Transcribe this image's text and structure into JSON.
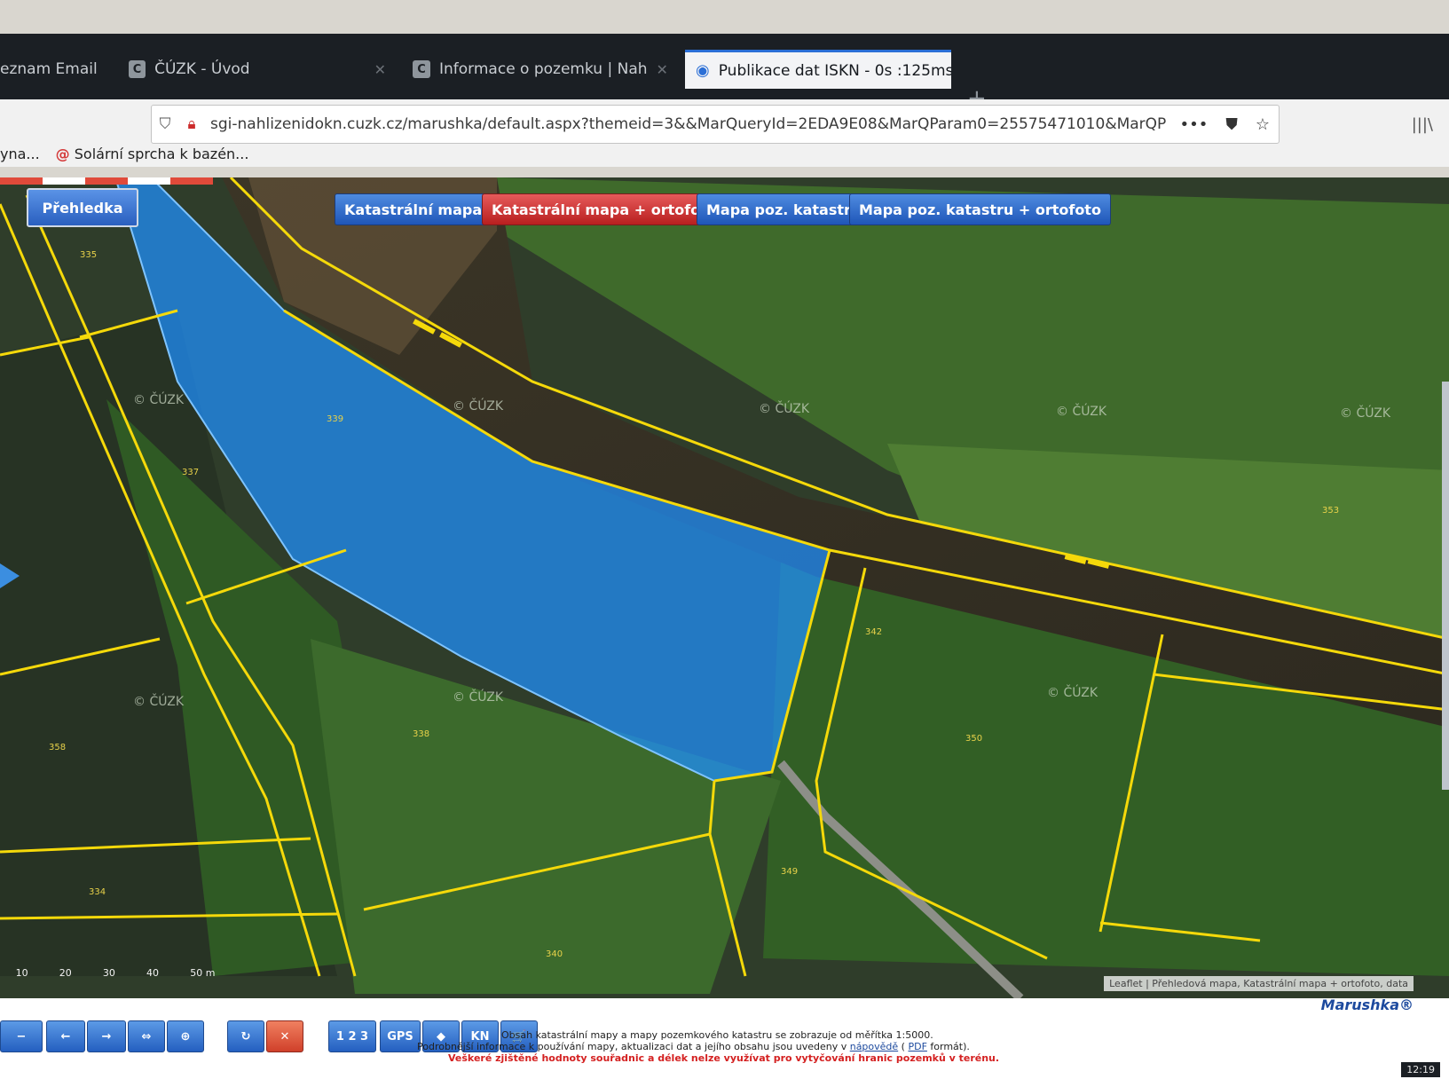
{
  "browser": {
    "tabs": [
      {
        "label": "eznam Email",
        "favicon": "email-icon",
        "active": false
      },
      {
        "label": "ČÚZK - Úvod",
        "favicon": "cuzk-icon",
        "active": false
      },
      {
        "label": "Informace o pozemku | Nah",
        "favicon": "cuzk-icon",
        "active": false
      },
      {
        "label": "Publikace dat ISKN - 0s :125ms,",
        "favicon": "globe-icon",
        "active": true
      }
    ],
    "new_tab_label": "+",
    "url": "sgi-nahlizenidokn.cuzk.cz/marushka/default.aspx?themeid=3&&MarQueryId=2EDA9E08&MarQParam0=25575471010&MarQP",
    "more_label": "•••",
    "bookmarks": [
      {
        "label": "yna...",
        "icon": "bookmark-icon"
      },
      {
        "label": "Solární sprcha k bazén...",
        "icon": "shop-icon"
      }
    ]
  },
  "map": {
    "overview_button": "Přehledka",
    "layer_buttons": [
      {
        "label": "Katastrální mapa",
        "active": false
      },
      {
        "label": "Katastrální mapa + ortofoto",
        "active": true
      },
      {
        "label": "Mapa poz. katastru",
        "active": false
      },
      {
        "label": "Mapa poz. katastru + ortofoto",
        "active": false
      }
    ],
    "watermark": "© ČÚZK",
    "parcel_numbers": [
      "335",
      "337",
      "338",
      "339",
      "349",
      "350",
      "353",
      "358",
      "334",
      "340",
      "342"
    ],
    "scale_labels": [
      "10",
      "20",
      "30",
      "40",
      "50 m"
    ],
    "attribution": "Leaflet | Přehledová mapa, Katastrální mapa + ortofoto, data"
  },
  "toolbar": {
    "buttons": [
      "−",
      "←",
      "→",
      "⇔",
      "⊕",
      "↻",
      "✕",
      "1 2 3",
      "GPS",
      "◆",
      "KN",
      "🛒"
    ],
    "brand": "Marushka®",
    "info_line1": "Obsah katastrální mapy a mapy pozemkového katastru se zobrazuje od měřítka 1:5000.",
    "info_line2_prefix": "Podrobnější informace k používání mapy, aktualizaci dat a jejího obsahu jsou uvedeny v",
    "info_line2_link1": "nápovědě",
    "info_line2_mid": "(",
    "info_line2_link2": "PDF",
    "info_line2_suffix": "formát).",
    "warning": "Veškeré zjištěné hodnoty souřadnic a délek nelze využívat pro vytyčování hranic pozemků v terénu.",
    "clock": "12:19"
  },
  "colors": {
    "selected_parcel": "#1e90ff",
    "parcel_border": "#f5d90a",
    "active_layer_button": "#c62828",
    "layer_button": "#2a62c4"
  }
}
